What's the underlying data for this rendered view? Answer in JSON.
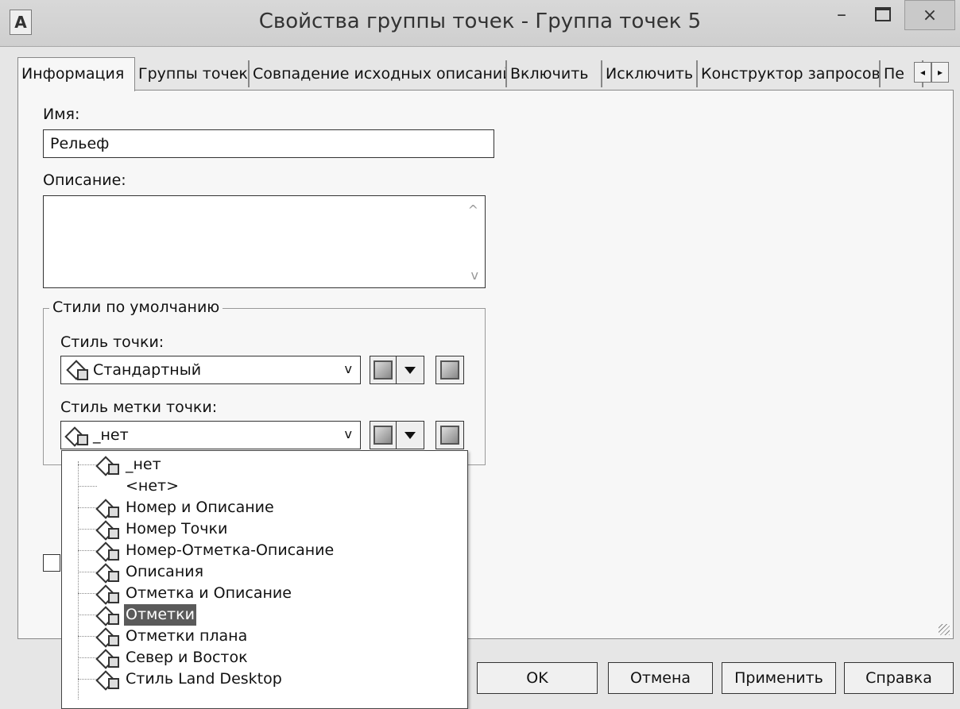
{
  "window": {
    "title": "Свойства группы точек - Группа точек 5",
    "app_icon": "A",
    "min_glyph": "–",
    "close_glyph": "×"
  },
  "tabs": [
    {
      "label": "Информация",
      "active": true
    },
    {
      "label": "Группы точек"
    },
    {
      "label": "Совпадение исходных описаний"
    },
    {
      "label": "Включить"
    },
    {
      "label": "Исключить"
    },
    {
      "label": "Конструктор запросов"
    },
    {
      "label": "Пе"
    }
  ],
  "tab_scroll": {
    "left": "◂",
    "right": "▸"
  },
  "form": {
    "name_label": "Имя:",
    "name_value": "Рельеф",
    "description_label": "Описание:",
    "description_value": "",
    "scroll_up": "^",
    "scroll_down": "v",
    "default_styles_title": "Стили по умолчанию",
    "point_style_label": "Стиль точки:",
    "point_style_value": "Стандартный",
    "label_style_label": "Стиль метки точки:",
    "label_style_value": "_нет",
    "combo_arrow": "v"
  },
  "dropdown": {
    "items": [
      {
        "label": "_нет",
        "icon": "label-style-icon"
      },
      {
        "label": "<нет>",
        "icon": ""
      },
      {
        "label": "Номер и Описание",
        "icon": "label-style-icon"
      },
      {
        "label": "Номер Точки",
        "icon": "label-style-icon"
      },
      {
        "label": "Номер-Отметка-Описание",
        "icon": "label-style-icon"
      },
      {
        "label": "Описания",
        "icon": "label-style-icon"
      },
      {
        "label": "Отметка и Описание",
        "icon": "label-style-icon"
      },
      {
        "label": "Отметки",
        "icon": "label-style-icon",
        "selected": true
      },
      {
        "label": "Отметки плана",
        "icon": "label-style-icon"
      },
      {
        "label": "Север и Восток",
        "icon": "label-style-icon"
      },
      {
        "label": "Стиль Land Desktop",
        "icon": "label-style-icon"
      }
    ]
  },
  "buttons": {
    "ok": "OK",
    "cancel": "Отмена",
    "apply": "Применить",
    "help": "Справка"
  }
}
